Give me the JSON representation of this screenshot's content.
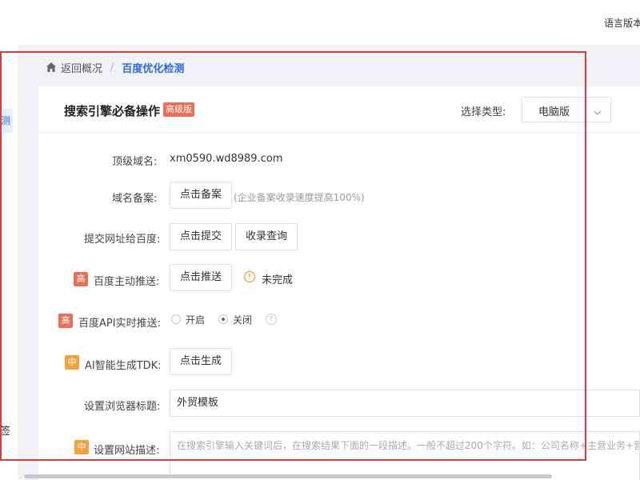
{
  "topbar": {
    "language_label": "语言版本"
  },
  "sidebar": {
    "selected_fragment": "测",
    "tag_fragment": "签"
  },
  "breadcrumb": {
    "back": "返回概况",
    "separator": "/",
    "current": "百度优化检测"
  },
  "card": {
    "title": "搜索引擎必备操作",
    "badge": "高级版",
    "type_label": "选择类型:",
    "type_value": "电脑版"
  },
  "rows": {
    "domain": {
      "label": "顶级域名:",
      "value": "xm0590.wd8989.com"
    },
    "icp": {
      "label": "域名备案:",
      "button": "点击备案",
      "hint": "(企业备案收录速度提高100%)"
    },
    "submit": {
      "label": "提交网址给百度:",
      "button1": "点击提交",
      "button2": "收录查询"
    },
    "push": {
      "level": "高",
      "label": "百度主动推送:",
      "button": "点击推送",
      "status": "未完成"
    },
    "api": {
      "level": "高",
      "label": "百度API实时推送:",
      "option_on": "开启",
      "option_off": "关闭",
      "help": "?"
    },
    "tdk": {
      "level": "中",
      "label": "AI智能生成TDK:",
      "button": "点击生成"
    },
    "browser_title": {
      "label": "设置浏览器标题:",
      "value": "外贸模板"
    },
    "description": {
      "level": "中",
      "label": "设置网站描述:",
      "placeholder": "在搜索引擎输入关键词后，在搜索结果下面的一段描述。一般不超过200个字符。如：公司名称+主营业务+营"
    }
  },
  "colors": {
    "accent": "#2f6bd6",
    "high": "#e8705a",
    "mid": "#f0a33a",
    "frame": "#e23b3b"
  },
  "icons": [
    "home-icon",
    "chevron-down-icon",
    "warning-icon",
    "help-icon"
  ]
}
